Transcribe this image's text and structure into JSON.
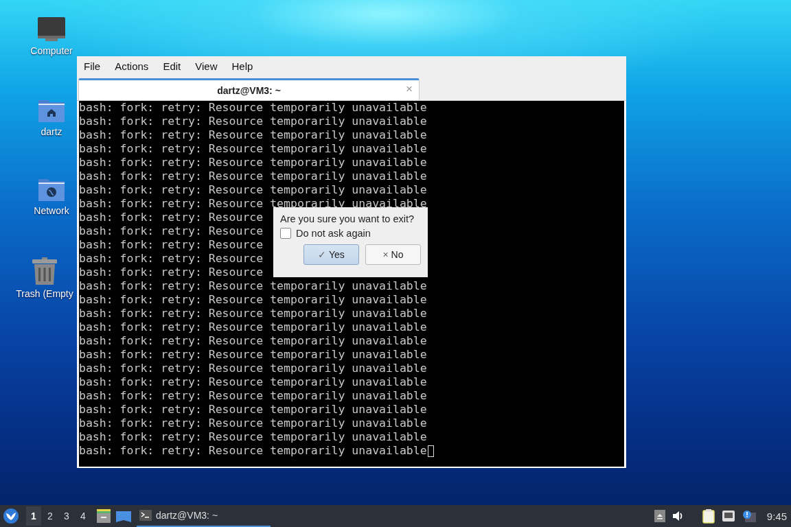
{
  "desktop_icons": [
    {
      "kind": "computer",
      "label": "Computer"
    },
    {
      "kind": "home-folder",
      "label": "dartz"
    },
    {
      "kind": "network-folder",
      "label": "Network"
    },
    {
      "kind": "trash",
      "label": "Trash (Empty"
    }
  ],
  "window": {
    "menu": [
      "File",
      "Actions",
      "Edit",
      "View",
      "Help"
    ],
    "tabs": [
      {
        "label": "dartz@VM3: ~",
        "selected": true,
        "close": "×"
      }
    ],
    "terminal_lines": [
      "bash: fork: retry: Resource temporarily unavailable",
      "bash: fork: retry: Resource temporarily unavailable",
      "bash: fork: retry: Resource temporarily unavailable",
      "bash: fork: retry: Resource temporarily unavailable",
      "bash: fork: retry: Resource temporarily unavailable",
      "bash: fork: retry: Resource temporarily unavailable",
      "bash: fork: retry: Resource temporarily unavailable",
      "bash: fork: retry: Resource temporarily unavailable",
      "bash: fork: retry: Resource",
      "bash: fork: retry: Resource",
      "bash: fork: retry: Resource",
      "bash: fork: retry: Resource",
      "bash: fork: retry: Resource",
      "bash: fork: retry: Resource temporarily unavailable",
      "bash: fork: retry: Resource temporarily unavailable",
      "bash: fork: retry: Resource temporarily unavailable",
      "bash: fork: retry: Resource temporarily unavailable",
      "bash: fork: retry: Resource temporarily unavailable",
      "bash: fork: retry: Resource temporarily unavailable",
      "bash: fork: retry: Resource temporarily unavailable",
      "bash: fork: retry: Resource temporarily unavailable",
      "bash: fork: retry: Resource temporarily unavailable",
      "bash: fork: retry: Resource temporarily unavailable",
      "bash: fork: retry: Resource temporarily unavailable",
      "bash: fork: retry: Resource temporarily unavailable",
      "bash: fork: retry: Resource temporarily unavailable"
    ]
  },
  "dialog": {
    "message": "Are you sure you want to exit?",
    "checkbox": {
      "label": "Do not ask again",
      "checked": false
    },
    "buttons": [
      {
        "icon": "✓",
        "label": "Yes",
        "selected": true
      },
      {
        "icon": "×",
        "label": "No",
        "selected": false
      }
    ]
  },
  "taskbar": {
    "workspaces": [
      {
        "label": "1",
        "selected": true
      },
      {
        "label": "2",
        "selected": false
      },
      {
        "label": "3",
        "selected": false
      },
      {
        "label": "4",
        "selected": false
      }
    ],
    "tasks": [
      {
        "label": "dartz@VM3: ~",
        "selected": true
      }
    ],
    "clock": "9:45"
  }
}
